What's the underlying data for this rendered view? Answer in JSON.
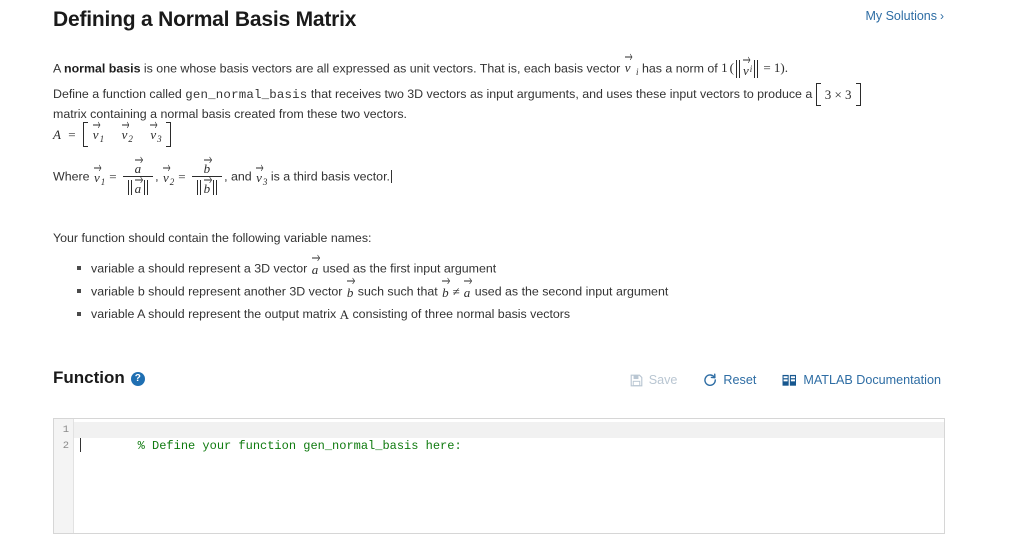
{
  "header": {
    "title": "Defining a Normal Basis Matrix",
    "my_solutions_label": "My Solutions",
    "my_solutions_chevron": "›",
    "link_color": "#2e6da4"
  },
  "intro": {
    "p1_before_bold": "A ",
    "p1_bold": "normal basis",
    "p1_after_bold": " is one whose basis vectors are all expressed as unit vectors. That is, each basis vector ",
    "p1_math_vector": "v",
    "p1_mid": " has a norm of ",
    "p1_one": "1",
    "p1_norm_open": "(",
    "p1_norm_eq": "= 1",
    "p1_norm_close": ").",
    "p2_part1": "Define a function called ",
    "p2_code": "gen_normal_basis",
    "p2_part2": " that receives two 3D vectors as input arguments, and uses these input vectors to produce a ",
    "p2_matrix_dims": "3 × 3",
    "p2_part3": " matrix containing a normal basis created from these two vectors."
  },
  "equation": {
    "lhs": "A",
    "equals": "=",
    "v1": "v",
    "v1_sub": "1",
    "v2": "v",
    "v2_sub": "2",
    "v3": "v",
    "v3_sub": "3"
  },
  "where_line": {
    "where": "Where ",
    "v1": "v",
    "v1_sub": "1",
    "eq1": "=",
    "num1": "a",
    "den1": "a",
    "comma1": ", ",
    "v2": "v",
    "v2_sub": "2",
    "eq2": "=",
    "num2": "b",
    "den2": "b",
    "and_text": ", and ",
    "v3": "v",
    "v3_sub": "3",
    "tail": " is a third basis vector."
  },
  "variables": {
    "heading": "Your function should contain the following variable names:",
    "items": [
      {
        "before": "variable a should represent a 3D vector ",
        "math": "a",
        "after": " used as the first input argument"
      },
      {
        "before": "variable b should represent another 3D vector ",
        "math": "b",
        "mid": " such such that ",
        "math2": "b",
        "neq": "≠",
        "math3": "a",
        "after": " used as the second input argument"
      },
      {
        "before": "variable A should represent the output matrix ",
        "math": "A",
        "after": " consisting of three normal basis vectors"
      }
    ]
  },
  "function_section": {
    "title": "Function",
    "help_icon_glyph": "?",
    "help_icon_name": "question-mark-icon",
    "toolbar": {
      "save_label": "Save",
      "save_enabled": false,
      "reset_label": "Reset",
      "documentation_label": "MATLAB Documentation"
    }
  },
  "editor": {
    "line_numbers": [
      "1",
      "2"
    ],
    "lines": [
      {
        "text": "% Define your function gen_normal_basis here:",
        "type": "comment"
      },
      {
        "text": "",
        "type": "empty"
      }
    ]
  },
  "colors": {
    "accent_blue": "#2e6da4",
    "help_blue": "#1f6fb2",
    "comment_green": "#0e7a0e",
    "gutter_bg": "#f4f4f4",
    "border": "#d6d6d6",
    "disabled": "#b9c6d2"
  }
}
